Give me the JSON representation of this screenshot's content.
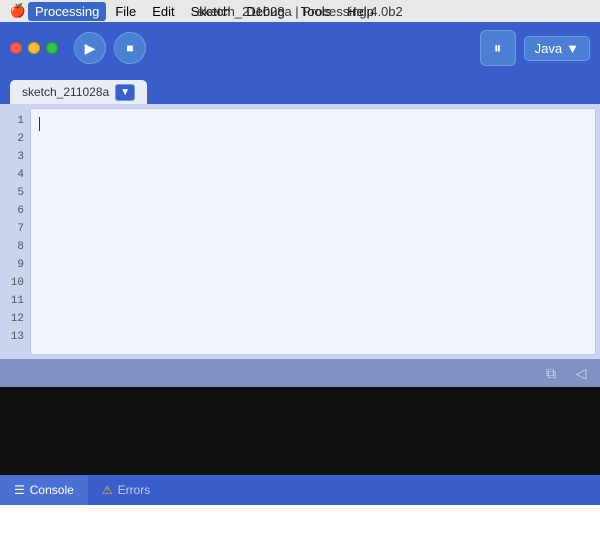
{
  "titlebar": {
    "apple": "🍎",
    "menu_items": [
      "Processing",
      "File",
      "Edit",
      "Sketch",
      "Debug",
      "Tools",
      "Help"
    ],
    "active_menu": "Processing",
    "title": "sketch_211028a | Processing 4.0b2"
  },
  "toolbar": {
    "run_icon": "▶",
    "stop_icon": "■",
    "debugger_icon": "⏸",
    "java_label": "Java",
    "dropdown_icon": "▼"
  },
  "tabs": {
    "sketch_tab": "sketch_211028a"
  },
  "editor": {
    "line_numbers": [
      "1",
      "2",
      "3",
      "4",
      "5",
      "6",
      "7",
      "8",
      "9",
      "10",
      "11",
      "12",
      "13"
    ]
  },
  "status_bar": {
    "copy_icon": "⧉",
    "back_icon": "◁"
  },
  "bottom_tabs": {
    "console_label": "Console",
    "errors_label": "Errors",
    "console_icon": "☰",
    "error_icon": "⚠"
  }
}
